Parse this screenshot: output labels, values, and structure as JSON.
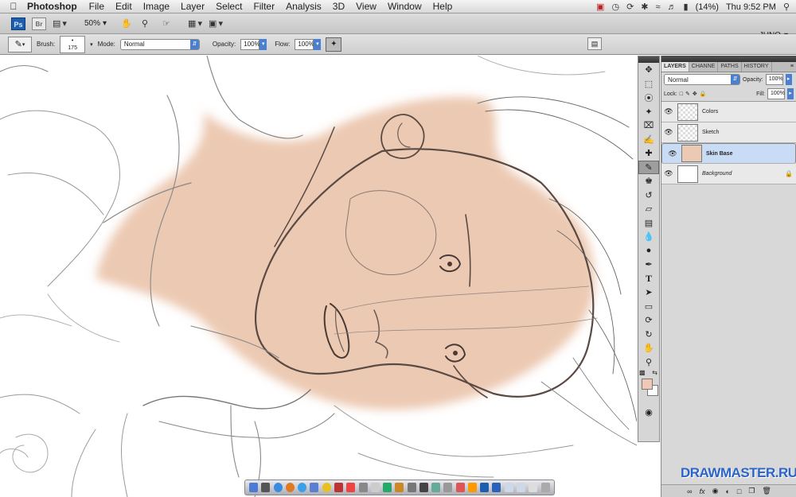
{
  "menubar": {
    "app_name": "Photoshop",
    "items": [
      "File",
      "Edit",
      "Image",
      "Layer",
      "Select",
      "Filter",
      "Analysis",
      "3D",
      "View",
      "Window",
      "Help"
    ],
    "battery": "(14%)",
    "clock": "Thu 9:52 PM"
  },
  "appbar": {
    "ps_label": "Ps",
    "br_label": "Br",
    "zoom": "50%",
    "workspace": "JUNO"
  },
  "options": {
    "brush_label": "Brush:",
    "brush_size": "175",
    "mode_label": "Mode:",
    "mode_value": "Normal",
    "opacity_label": "Opacity:",
    "opacity_value": "100%",
    "flow_label": "Flow:",
    "flow_value": "100%"
  },
  "layers_panel": {
    "tabs": [
      "LAYERS",
      "CHANNE",
      "PATHS",
      "HISTORY"
    ],
    "blend_mode": "Normal",
    "opacity_label": "Opacity:",
    "opacity_value": "100%",
    "lock_label": "Lock:",
    "fill_label": "Fill:",
    "fill_value": "100%",
    "layers": [
      {
        "name": "Colors",
        "thumb": "transparent",
        "selected": false
      },
      {
        "name": "Sketch",
        "thumb": "transparent",
        "selected": false
      },
      {
        "name": "Skin Base",
        "thumb": "skin",
        "selected": true
      },
      {
        "name": "Background",
        "thumb": "white",
        "selected": false,
        "locked": true
      }
    ]
  },
  "colors": {
    "skin": "#ecc9b2",
    "foreground": "#f0c8b4",
    "background": "#ffffff",
    "accent": "#1d5fae"
  },
  "watermark": "DRAWMASTER.RU"
}
